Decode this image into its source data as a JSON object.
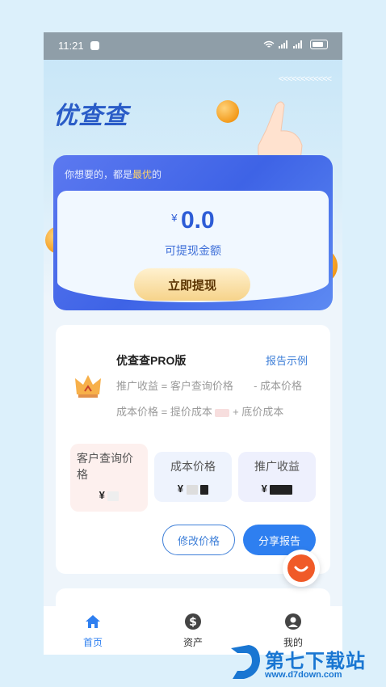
{
  "status_bar": {
    "time": "11:21",
    "icons": "wifi-icon signal-icon signal-icon battery-icon"
  },
  "app": {
    "logo": "优查查",
    "chevrons": "<<<<<<<<<<<<"
  },
  "balance_card": {
    "slogan_prefix": "你想要的，都是",
    "slogan_highlight": "最优",
    "slogan_suffix": "的",
    "currency": "¥",
    "amount": "0.0",
    "amount_label": "可提现金额",
    "withdraw_label": "立即提现"
  },
  "product": {
    "title": "优查查PRO版",
    "report_link": "报告示例",
    "formula1_a": "推广收益 = 客户查询价格",
    "formula1_b": "- 成本价格",
    "formula2_a": "成本价格 = 提价成本",
    "formula2_b": "+ 底价成本",
    "stats": [
      {
        "label": "客户查询价格",
        "currency": "¥"
      },
      {
        "label": "成本价格",
        "currency": "¥"
      },
      {
        "label": "推广收益",
        "currency": "¥"
      }
    ],
    "edit_label": "修改价格",
    "share_label": "分享报告"
  },
  "tabs": [
    {
      "label": "首页",
      "icon": "home-icon"
    },
    {
      "label": "资产",
      "icon": "dollar-icon"
    },
    {
      "label": "我的",
      "icon": "user-icon"
    }
  ],
  "watermark": {
    "name": "第七下载站",
    "url": "www.d7down.com"
  },
  "colors": {
    "primary": "#2e7ff0",
    "card": "#3e63e6",
    "accent": "#f39b1c"
  }
}
